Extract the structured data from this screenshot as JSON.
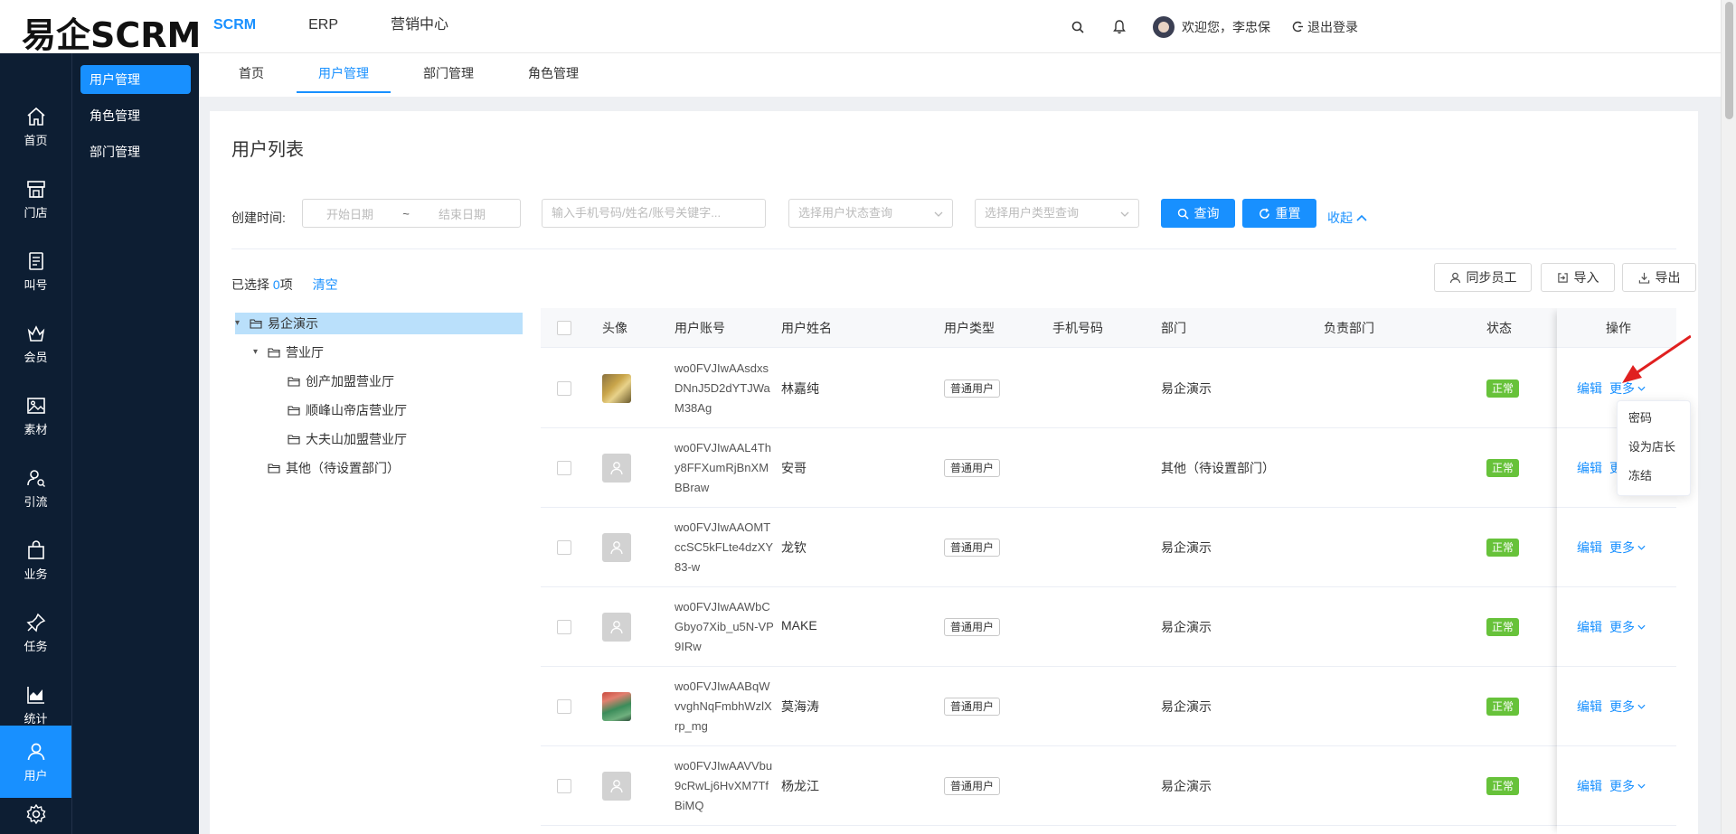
{
  "app": {
    "logo": "易企SCRM"
  },
  "topnav": [
    {
      "label": "SCRM",
      "active": true
    },
    {
      "label": "ERP",
      "active": false
    },
    {
      "label": "营销中心",
      "active": false
    }
  ],
  "topbar": {
    "greeting": "欢迎您，李忠保",
    "logout": "退出登录"
  },
  "sidebar": [
    {
      "label": "首页",
      "icon": "home-icon"
    },
    {
      "label": "门店",
      "icon": "store-icon"
    },
    {
      "label": "叫号",
      "icon": "queue-icon"
    },
    {
      "label": "会员",
      "icon": "member-icon"
    },
    {
      "label": "素材",
      "icon": "image-icon"
    },
    {
      "label": "引流",
      "icon": "traffic-icon"
    },
    {
      "label": "业务",
      "icon": "bag-icon"
    },
    {
      "label": "任务",
      "icon": "pin-icon"
    },
    {
      "label": "统计",
      "icon": "chart-icon"
    },
    {
      "label": "用户",
      "icon": "user-icon",
      "active": true
    },
    {
      "label": "",
      "icon": "gear-icon"
    }
  ],
  "subside": [
    {
      "label": "用户管理",
      "active": true
    },
    {
      "label": "角色管理",
      "active": false
    },
    {
      "label": "部门管理",
      "active": false
    }
  ],
  "tabs": [
    {
      "label": "首页",
      "active": false
    },
    {
      "label": "用户管理",
      "active": true
    },
    {
      "label": "部门管理",
      "active": false
    },
    {
      "label": "角色管理",
      "active": false
    }
  ],
  "panel": {
    "title": "用户列表"
  },
  "filters": {
    "created_label": "创建时间:",
    "start_placeholder": "开始日期",
    "range_sep": "~",
    "end_placeholder": "结束日期",
    "keyword_placeholder": "输入手机号码/姓名/账号关键字...",
    "status_placeholder": "选择用户状态查询",
    "type_placeholder": "选择用户类型查询",
    "search_label": "查询",
    "reset_label": "重置",
    "collapse_label": "收起"
  },
  "selection": {
    "prefix": "已选择 ",
    "count": "0",
    "suffix": "项",
    "clear": "清空"
  },
  "actions": {
    "sync": "同步员工",
    "import": "导入",
    "export": "导出"
  },
  "tree": {
    "root": "易企演示",
    "hall": "营业厅",
    "children": [
      "创产加盟营业厅",
      "顺峰山帝店营业厅",
      "大夫山加盟营业厅"
    ],
    "other": "其他（待设置部门）"
  },
  "table": {
    "columns": [
      "头像",
      "用户账号",
      "用户姓名",
      "用户类型",
      "手机号码",
      "部门",
      "负责部门",
      "状态",
      "操作"
    ],
    "rows": [
      {
        "avatar": "photo1",
        "account": "wo0FVJIwAAsdxsDNnJ5D2dYTJWaM38Ag",
        "name": "林嘉纯",
        "type": "普通用户",
        "phone": "",
        "dept": "易企演示",
        "resp": "",
        "status": "正常"
      },
      {
        "avatar": "default",
        "account": "wo0FVJIwAAL4Thy8FFXumRjBnXMBBraw",
        "name": "安哥",
        "type": "普通用户",
        "phone": "",
        "dept": "其他（待设置部门）",
        "resp": "",
        "status": "正常"
      },
      {
        "avatar": "default",
        "account": "wo0FVJIwAAOMTccSC5kFLte4dzXY83-w",
        "name": "龙钦",
        "type": "普通用户",
        "phone": "",
        "dept": "易企演示",
        "resp": "",
        "status": "正常"
      },
      {
        "avatar": "default",
        "account": "wo0FVJIwAAWbCGbyo7Xib_u5N-VP9IRw",
        "name": "MAKE",
        "type": "普通用户",
        "phone": "",
        "dept": "易企演示",
        "resp": "",
        "status": "正常"
      },
      {
        "avatar": "photo2",
        "account": "wo0FVJIwAABqWvvghNqFmbhWzlXrp_mg",
        "name": "莫海涛",
        "type": "普通用户",
        "phone": "",
        "dept": "易企演示",
        "resp": "",
        "status": "正常"
      },
      {
        "avatar": "default",
        "account": "wo0FVJIwAAVVbu9cRwLj6HvXM7TfBiMQ",
        "name": "杨龙江",
        "type": "普通用户",
        "phone": "",
        "dept": "易企演示",
        "resp": "",
        "status": "正常"
      }
    ],
    "op_edit": "编辑",
    "op_more": "更多"
  },
  "dropdown": [
    "密码",
    "设为店长",
    "冻结"
  ],
  "colors": {
    "primary": "#1890ff",
    "sidebar": "#0d1e33",
    "success": "#67c23a",
    "annotation": "#e02020"
  }
}
